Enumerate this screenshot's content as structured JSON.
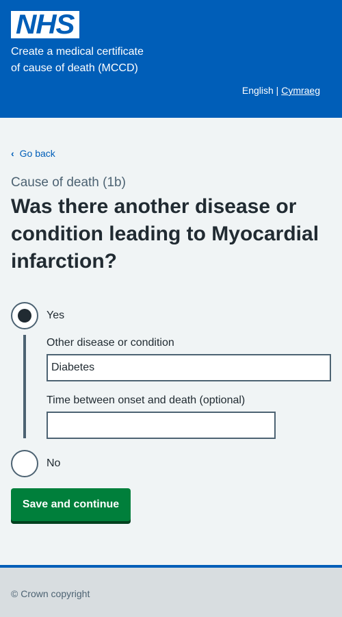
{
  "header": {
    "logo_text": "NHS",
    "service_name_line1": "Create a medical certificate",
    "service_name_line2": "of cause of death (MCCD)",
    "lang_current": "English",
    "lang_separator": "|",
    "lang_other": "Cymraeg"
  },
  "nav": {
    "back_label": "Go back"
  },
  "question": {
    "caption": "Cause of death (1b)",
    "heading": "Was there another disease or condition leading to Myocardial infarction?"
  },
  "options": {
    "yes_label": "Yes",
    "yes_selected": true,
    "no_label": "No",
    "no_selected": false
  },
  "conditional": {
    "disease_label": "Other disease or condition",
    "disease_value": "Diabetes",
    "onset_label": "Time between onset and death (optional)",
    "onset_value": ""
  },
  "actions": {
    "save_label": "Save and continue"
  },
  "footer": {
    "copyright": "© Crown copyright"
  },
  "colors": {
    "nhs_blue": "#005eb8",
    "button_green": "#007f3b",
    "text": "#212b32",
    "secondary_text": "#4c6272",
    "page_bg": "#f0f4f5",
    "footer_bg": "#d8dde0"
  }
}
